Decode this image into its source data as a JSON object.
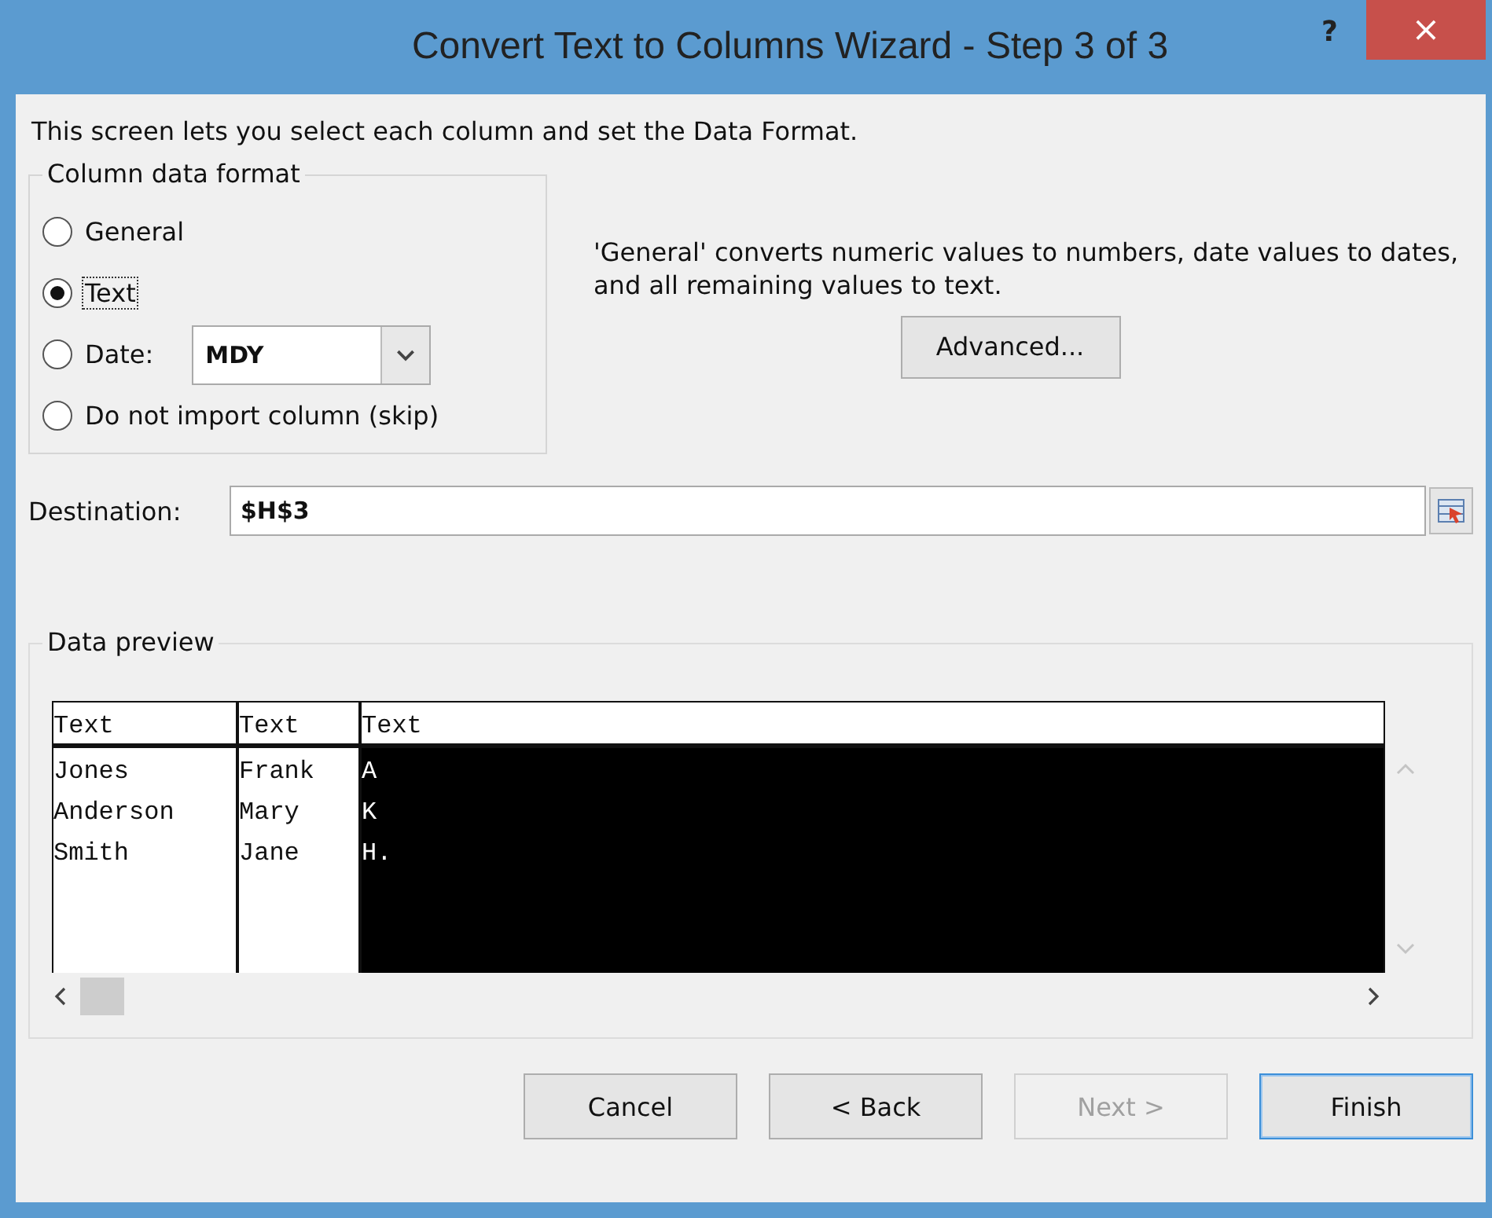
{
  "window": {
    "title": "Convert Text to Columns Wizard - Step 3 of 3",
    "help": "?",
    "close": "×"
  },
  "intro": "This screen lets you select each column and set the Data Format.",
  "format_group": {
    "legend": "Column data format",
    "options": [
      {
        "label": "General",
        "selected": false,
        "kind": "plain"
      },
      {
        "label": "Text",
        "selected": true,
        "kind": "plain"
      },
      {
        "label": "Date:",
        "selected": false,
        "kind": "date"
      },
      {
        "label": "Do not import column (skip)",
        "selected": false,
        "kind": "plain"
      }
    ],
    "date_value": "MDY"
  },
  "description": "'General' converts numeric values to numbers, date values to dates, and all remaining values to text.",
  "advanced_button": "Advanced...",
  "destination": {
    "label": "Destination:",
    "value": "$H$3"
  },
  "preview": {
    "legend": "Data preview",
    "columns": [
      {
        "header": "Text",
        "selected": false,
        "cells": [
          "Jones",
          "Anderson",
          "Smith"
        ]
      },
      {
        "header": "Text",
        "selected": false,
        "cells": [
          "Frank",
          "Mary",
          "Jane"
        ]
      },
      {
        "header": "Text",
        "selected": true,
        "cells": [
          "A",
          "K",
          "H."
        ]
      }
    ]
  },
  "buttons": [
    {
      "label": "Cancel",
      "disabled": false,
      "default": false
    },
    {
      "label": "< Back",
      "disabled": false,
      "default": false
    },
    {
      "label": "Next >",
      "disabled": true,
      "default": false
    },
    {
      "label": "Finish",
      "disabled": false,
      "default": true
    }
  ]
}
